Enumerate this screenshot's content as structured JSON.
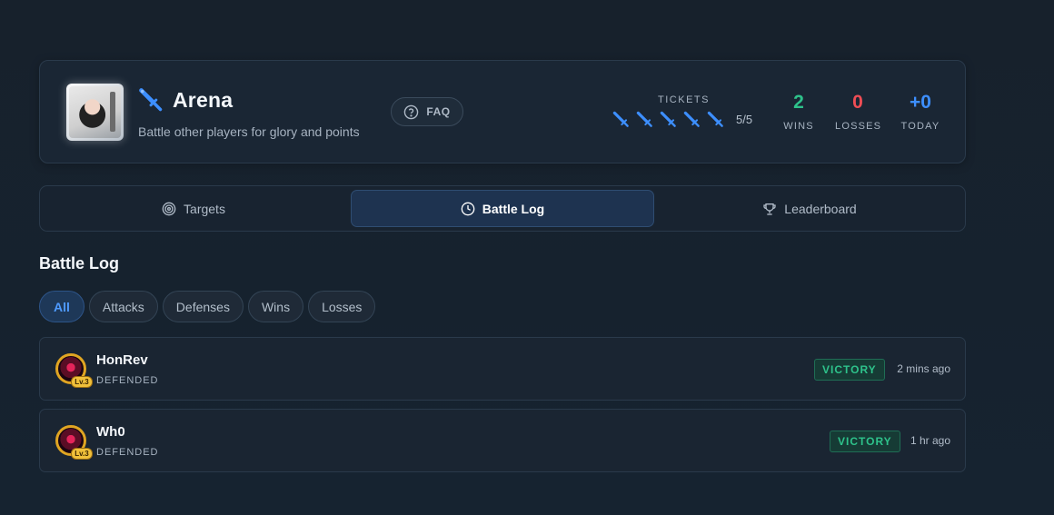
{
  "header": {
    "title": "Arena",
    "subtitle": "Battle other players for glory and points",
    "title_icon": "sword-icon",
    "faq_label": "FAQ",
    "tickets_label": "TICKETS",
    "tickets_count": "5/5",
    "ticket_icon": "sword-ticket-icon",
    "stats": {
      "wins_value": "2",
      "wins_label": "WINS",
      "losses_value": "0",
      "losses_label": "LOSSES",
      "today_value": "+0",
      "today_label": "TODAY"
    },
    "colors": {
      "wins": "#2ec28b",
      "losses": "#ef4d55",
      "today": "#3d8fff"
    }
  },
  "tabs": [
    {
      "label": "Targets",
      "icon": "target-icon",
      "active": false
    },
    {
      "label": "Battle Log",
      "icon": "clock-icon",
      "active": true
    },
    {
      "label": "Leaderboard",
      "icon": "trophy-icon",
      "active": false
    }
  ],
  "section_title": "Battle Log",
  "filters": [
    {
      "label": "All",
      "active": true
    },
    {
      "label": "Attacks",
      "active": false
    },
    {
      "label": "Defenses",
      "active": false
    },
    {
      "label": "Wins",
      "active": false
    },
    {
      "label": "Losses",
      "active": false
    }
  ],
  "log": [
    {
      "name": "HonRev",
      "level": "Lv.3",
      "status": "DEFENDED",
      "result": "VICTORY",
      "time": "2 mins ago"
    },
    {
      "name": "Wh0",
      "level": "Lv.3",
      "status": "DEFENDED",
      "result": "VICTORY",
      "time": "1 hr ago"
    }
  ]
}
